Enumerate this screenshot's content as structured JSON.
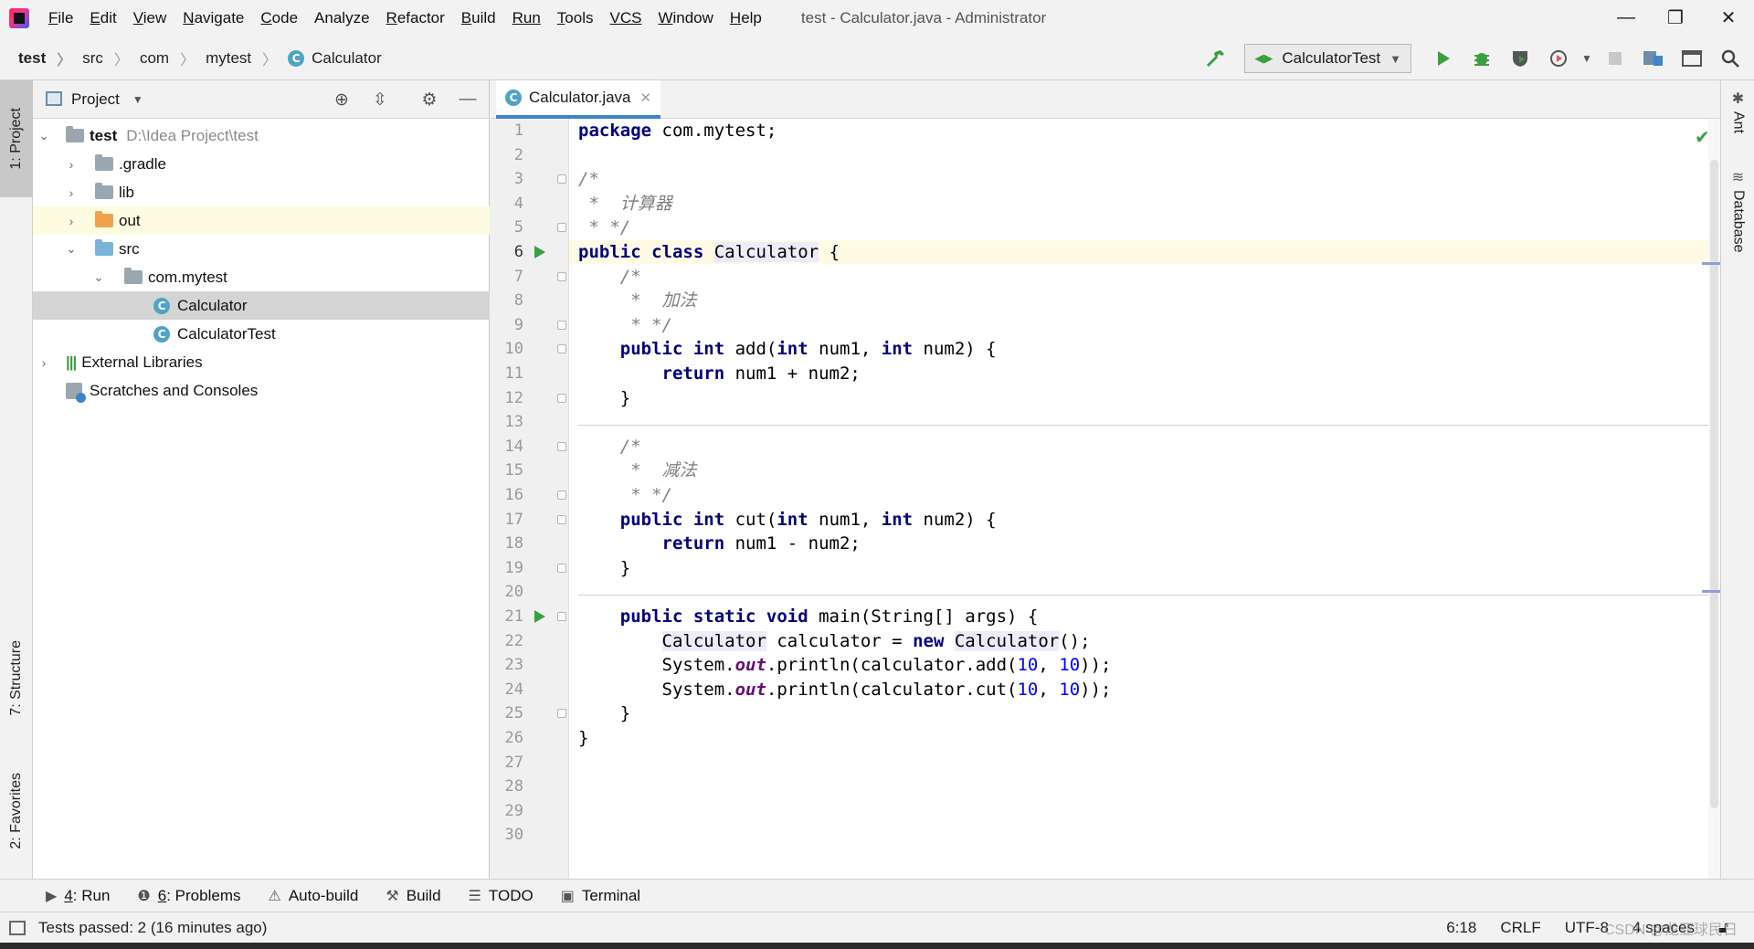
{
  "window": {
    "title": "test - Calculator.java - Administrator",
    "menu": [
      {
        "label": "File",
        "mnemonic": "F",
        "rest": "ile"
      },
      {
        "label": "Edit",
        "mnemonic": "E",
        "rest": "dit"
      },
      {
        "label": "View",
        "mnemonic": "V",
        "rest": "iew"
      },
      {
        "label": "Navigate",
        "mnemonic": "N",
        "rest": "avigate"
      },
      {
        "label": "Code",
        "mnemonic": "C",
        "rest": "ode"
      },
      {
        "label": "Analyze",
        "mnemonic": "",
        "rest": "Analyze"
      },
      {
        "label": "Refactor",
        "mnemonic": "R",
        "rest": "efactor"
      },
      {
        "label": "Build",
        "mnemonic": "B",
        "rest": "uild"
      },
      {
        "label": "Run",
        "mnemonic": "",
        "rest": "Run"
      },
      {
        "label": "Tools",
        "mnemonic": "T",
        "rest": "ools"
      },
      {
        "label": "VCS",
        "mnemonic": "",
        "rest": "VCS"
      },
      {
        "label": "Window",
        "mnemonic": "W",
        "rest": "indow"
      },
      {
        "label": "Help",
        "mnemonic": "H",
        "rest": "elp"
      }
    ],
    "controls": {
      "minimize": "—",
      "restore": "❐",
      "close": "✕"
    }
  },
  "navbar": {
    "breadcrumbs": [
      "test",
      "src",
      "com",
      "mytest",
      "Calculator"
    ],
    "run_config": "CalculatorTest",
    "class_icon_letter": "C"
  },
  "left_stripe": {
    "project": "1: Project",
    "structure": "7: Structure",
    "favorites": "2: Favorites"
  },
  "right_stripe": {
    "ant": "Ant",
    "database": "Database"
  },
  "project_panel": {
    "title": "Project",
    "tree": {
      "root_name": "test",
      "root_path": "D:\\Idea Project\\test",
      "gradle": ".gradle",
      "lib": "lib",
      "out": "out",
      "src": "src",
      "package": "com.mytest",
      "class1": "Calculator",
      "class2": "CalculatorTest",
      "ext_libs": "External Libraries",
      "scratches": "Scratches and Consoles"
    }
  },
  "editor": {
    "tab_label": "Calculator.java",
    "line_numbers": [
      "1",
      "2",
      "3",
      "4",
      "5",
      "6",
      "7",
      "8",
      "9",
      "10",
      "11",
      "12",
      "13",
      "14",
      "15",
      "16",
      "17",
      "18",
      "19",
      "20",
      "21",
      "22",
      "23",
      "24",
      "25",
      "26",
      "27",
      "28",
      "29",
      "30"
    ],
    "code": {
      "l1_kw": "package",
      "l1_rest": " com.mytest;",
      "l3": "/*",
      "l4": " *  计算器",
      "l5": " * */",
      "l6_kw": "public class",
      "l6_cls": "Calculator",
      "l6_rest": " {",
      "l7": "    /*",
      "l8": "     *  加法",
      "l9": "     * */",
      "l10_kw1": "    public int",
      "l10_m": " add(",
      "l10_kw2": "int",
      "l10_a": " num1, ",
      "l10_kw3": "int",
      "l10_b": " num2) {",
      "l11_kw": "        return",
      "l11_rest": " num1 + num2;",
      "l12": "    }",
      "l14": "    /*",
      "l15": "     *  减法",
      "l16": "     * */",
      "l17_kw1": "    public int",
      "l17_m": " cut(",
      "l17_kw2": "int",
      "l17_a": " num1, ",
      "l17_kw3": "int",
      "l17_b": " num2) {",
      "l18_kw": "        return",
      "l18_rest": " num1 - num2;",
      "l19": "    }",
      "l21_kw": "    public static void",
      "l21_rest": " main(String[] args) {",
      "l22_pre": "        ",
      "l22_cls1": "Calculator",
      "l22_mid": " calculator = ",
      "l22_kw": "new",
      "l22_sp": " ",
      "l22_cls2": "Calculator",
      "l22_end": "();",
      "l23_pre": "        System.",
      "l23_fld": "out",
      "l23_mid": ".println(calculator.add(",
      "l23_n1": "10",
      "l23_c": ", ",
      "l23_n2": "10",
      "l23_end": "));",
      "l24_pre": "        System.",
      "l24_fld": "out",
      "l24_mid": ".println(calculator.cut(",
      "l24_n1": "10",
      "l24_c": ", ",
      "l24_n2": "10",
      "l24_end": "));",
      "l25": "    }",
      "l26": "}"
    }
  },
  "bottom_tools": {
    "run_num": "4",
    "run_label": ": Run",
    "problems_num": "6",
    "problems_label": ": Problems",
    "autobuild": "Auto-build",
    "build": "Build",
    "todo": "TODO",
    "terminal": "Terminal"
  },
  "statusbar": {
    "message": "Tests passed: 2 (16 minutes ago)",
    "position": "6:18",
    "line_sep": "CRLF",
    "encoding": "UTF-8",
    "indent": "4 spaces",
    "watermark": "CSDN @龙亚球民日"
  },
  "colors": {
    "keyword": "#000080",
    "comment": "#808080",
    "number": "#0000ff",
    "field": "#660e7a",
    "run_green": "#3aa03f",
    "tab_underline": "#4083c9"
  }
}
